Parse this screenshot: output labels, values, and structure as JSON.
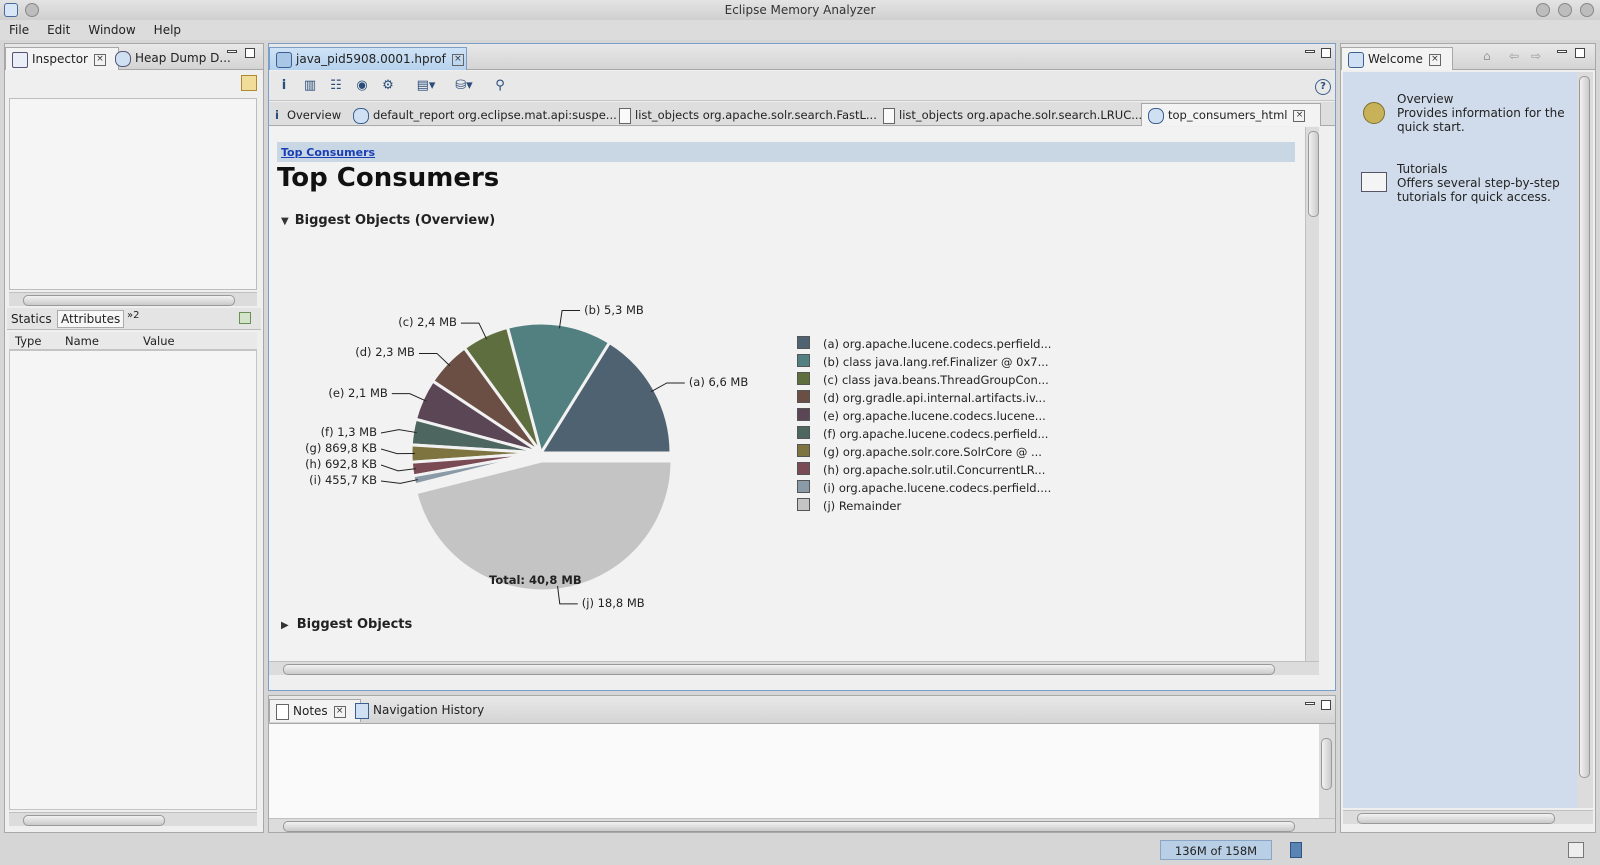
{
  "window": {
    "title": "Eclipse Memory Analyzer"
  },
  "menu": [
    "File",
    "Edit",
    "Window",
    "Help"
  ],
  "left_panel": {
    "tabs": [
      "Inspector",
      "Heap Dump D..."
    ],
    "attr_tabs": [
      "Statics",
      "Attributes",
      "»2"
    ],
    "columns": [
      "Type",
      "Name",
      "Value"
    ]
  },
  "editor": {
    "file_tab": "java_pid5908.0001.hprof",
    "subtabs": [
      "Overview",
      "default_report  org.eclipse.mat.api:suspe...",
      "list_objects org.apache.solr.search.FastL...",
      "list_objects org.apache.solr.search.LRUC...",
      "top_consumers_html"
    ],
    "breadcrumb": "Top Consumers",
    "heading": "Top Consumers",
    "section1": "Biggest Objects (Overview)",
    "section2": "Biggest Objects",
    "total": "Total: 40,8 MB"
  },
  "chart_data": {
    "type": "pie",
    "title": "",
    "total_mb": 40.8,
    "slices": [
      {
        "key": "(a)",
        "label": "6,6 MB",
        "value_mb": 6.6,
        "legend": "org.apache.lucene.codecs.perfield...",
        "color": "#4f6272"
      },
      {
        "key": "(b)",
        "label": "5,3 MB",
        "value_mb": 5.3,
        "legend": "class java.lang.ref.Finalizer @ 0x7...",
        "color": "#527f7f"
      },
      {
        "key": "(c)",
        "label": "2,4 MB",
        "value_mb": 2.4,
        "legend": "class java.beans.ThreadGroupCon...",
        "color": "#5f6e3e"
      },
      {
        "key": "(d)",
        "label": "2,3 MB",
        "value_mb": 2.3,
        "legend": "org.gradle.api.internal.artifacts.iv...",
        "color": "#6b4f45"
      },
      {
        "key": "(e)",
        "label": "2,1 MB",
        "value_mb": 2.1,
        "legend": "org.apache.lucene.codecs.lucene...",
        "color": "#5a4655"
      },
      {
        "key": "(f)",
        "label": "1,3 MB",
        "value_mb": 1.3,
        "legend": "org.apache.lucene.codecs.perfield...",
        "color": "#4d6660"
      },
      {
        "key": "(g)",
        "label": "869,8 KB",
        "value_mb": 0.8694,
        "legend": "org.apache.solr.core.SolrCore @ ...",
        "color": "#7e7440"
      },
      {
        "key": "(h)",
        "label": "692,8 KB",
        "value_mb": 0.6925,
        "legend": "org.apache.solr.util.ConcurrentLR...",
        "color": "#7a4a55"
      },
      {
        "key": "(i)",
        "label": "455,7 KB",
        "value_mb": 0.4555,
        "legend": "org.apache.lucene.codecs.perfield....",
        "color": "#8a9aa6"
      },
      {
        "key": "(j)",
        "label": "18,8 MB",
        "value_mb": 18.8,
        "legend": "Remainder",
        "color": "#c4c4c4"
      }
    ]
  },
  "bottom_panel": {
    "tabs": [
      "Notes",
      "Navigation History"
    ]
  },
  "right_panel": {
    "tab": "Welcome",
    "items": [
      {
        "title": "Overview",
        "desc": "Provides information for the quick start."
      },
      {
        "title": "Tutorials",
        "desc": "Offers several step-by-step tutorials for quick access."
      }
    ]
  },
  "status": {
    "heap": "136M of 158M"
  }
}
